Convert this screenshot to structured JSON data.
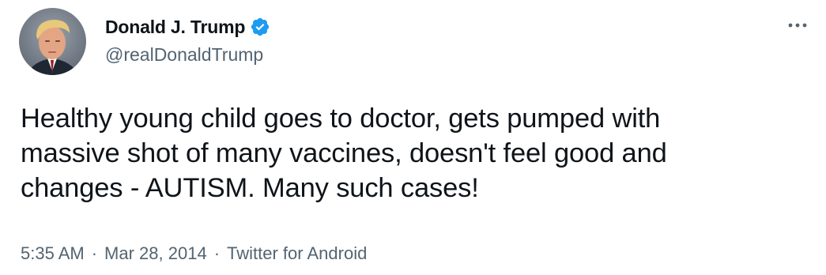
{
  "author": {
    "display_name": "Donald J. Trump",
    "handle": "@realDonaldTrump",
    "verified": true
  },
  "tweet": {
    "text": "Healthy young child goes to doctor, gets pumped with\nmassive shot of many vaccines, doesn't feel good and\nchanges - AUTISM. Many such cases!",
    "time": "5:35 AM",
    "separator": "·",
    "date": "Mar 28, 2014",
    "source": "Twitter for Android"
  },
  "icons": {
    "verified": "verified-badge-icon",
    "more": "more-options-icon",
    "avatar": "profile-avatar"
  },
  "colors": {
    "text_primary": "#0f1419",
    "text_secondary": "#536471",
    "verified_blue": "#1d9bf0",
    "background": "#ffffff"
  }
}
